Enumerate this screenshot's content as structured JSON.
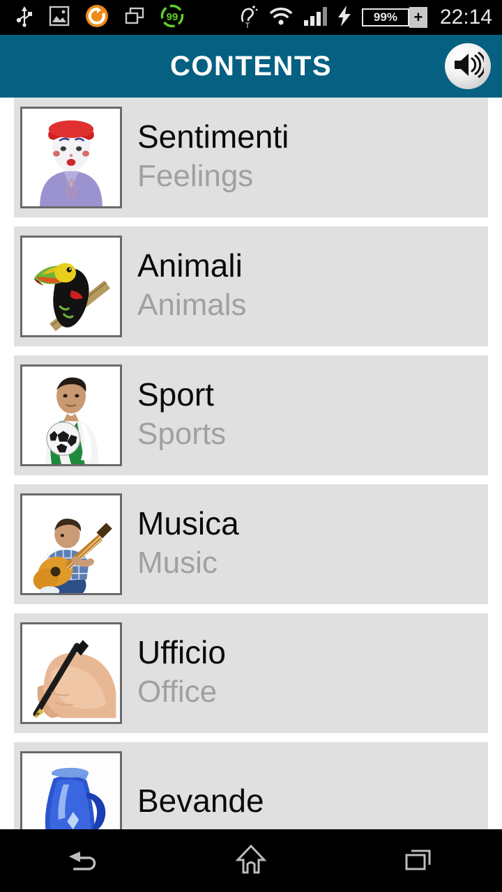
{
  "status_bar": {
    "clock": "22:14",
    "battery_percent": "99%",
    "battery_plus": "+",
    "left_icons": [
      {
        "name": "usb-icon",
        "label": "USB"
      },
      {
        "name": "screenshot-image-icon",
        "label": "Screenshot"
      },
      {
        "name": "sync-circle-icon",
        "label": "Sync"
      },
      {
        "name": "screen-mirror-icon",
        "label": "Screen mirroring"
      },
      {
        "name": "battery-saver-99-icon",
        "label": "99"
      }
    ],
    "right_icons": [
      {
        "name": "hearing-aid-t-icon",
        "label": "Hearing aid T"
      },
      {
        "name": "wifi-icon",
        "label": "Wi-Fi"
      },
      {
        "name": "cellular-signal-icon",
        "label": "Signal"
      },
      {
        "name": "charging-bolt-icon",
        "label": "Charging"
      },
      {
        "name": "battery-icon",
        "label": "Battery"
      }
    ]
  },
  "header": {
    "title": "CONTENTS",
    "sound_button_icon": "speaker-volume-icon",
    "accent_color": "#066081"
  },
  "list": {
    "items": [
      {
        "primary": "Sentimenti",
        "secondary": "Feelings",
        "thumb_icon": "mime-woman-red-hat-photo"
      },
      {
        "primary": "Animali",
        "secondary": "Animals",
        "thumb_icon": "toucan-bird-photo"
      },
      {
        "primary": "Sport",
        "secondary": "Sports",
        "thumb_icon": "soccer-player-photo"
      },
      {
        "primary": "Musica",
        "secondary": "Music",
        "thumb_icon": "guitar-player-photo"
      },
      {
        "primary": "Ufficio",
        "secondary": "Office",
        "thumb_icon": "hand-writing-pen-photo"
      },
      {
        "primary": "Bevande",
        "secondary": "",
        "thumb_icon": "blue-pitcher-photo"
      }
    ]
  },
  "nav_bar": {
    "buttons": [
      {
        "name": "back-button",
        "icon": "back-arrow-icon"
      },
      {
        "name": "home-button",
        "icon": "home-icon"
      },
      {
        "name": "recents-button",
        "icon": "recents-icon"
      }
    ]
  },
  "colors": {
    "header_teal": "#066081",
    "row_background": "#e0e0e0",
    "primary_text": "#0a0a0a",
    "secondary_text": "#a0a0a0",
    "nav_background": "#000000"
  }
}
